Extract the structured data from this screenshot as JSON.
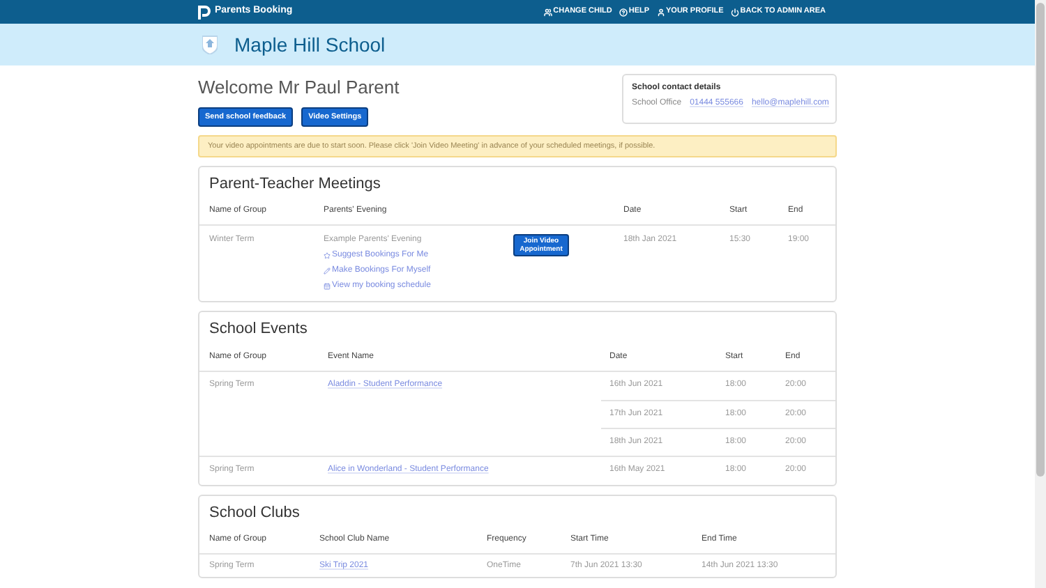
{
  "navbar": {
    "brand": "Parents Booking",
    "links": [
      {
        "label": "CHANGE CHILD"
      },
      {
        "label": "HELP"
      },
      {
        "label": "YOUR PROFILE"
      },
      {
        "label": "BACK TO ADMIN AREA"
      }
    ]
  },
  "school": {
    "name": "Maple Hill School"
  },
  "welcome": "Welcome Mr Paul Parent",
  "buttons": [
    "Send school feedback",
    "Video Settings"
  ],
  "contact": {
    "title": "School contact details",
    "label": "School Office",
    "phone": "01444 555666",
    "email": "hello@maplehill.com"
  },
  "alert": "Your video appointments are due to start soon. Please click 'Join Video Meeting' in advance of your scheduled meetings, if possible.",
  "meetings": {
    "title": "Parent-Teacher Meetings",
    "columns": [
      "Name of Group",
      "Parents' Evening",
      "Date",
      "Start",
      "End"
    ],
    "rows": [
      {
        "group": "Winter Term",
        "event": "Example Parents' Evening",
        "links": [
          "Suggest Bookings For Me",
          "Make Bookings For Myself",
          "View my booking schedule"
        ],
        "button": "Join Video Appointment",
        "date": "18th Jan 2021",
        "start": "15:30",
        "end": "19:00"
      }
    ]
  },
  "events": {
    "title": "School Events",
    "columns": [
      "Name of Group",
      "Event Name",
      "Date",
      "Start",
      "End"
    ],
    "rows": [
      {
        "group": "Spring Term",
        "event": "Aladdin - Student Performance",
        "sessions": [
          {
            "date": "16th Jun 2021",
            "start": "18:00",
            "end": "20:00"
          },
          {
            "date": "17th Jun 2021",
            "start": "18:00",
            "end": "20:00"
          },
          {
            "date": "18th Jun 2021",
            "start": "18:00",
            "end": "20:00"
          }
        ]
      },
      {
        "group": "Spring Term",
        "event": "Alice in Wonderland - Student Performance",
        "sessions": [
          {
            "date": "16th May 2021",
            "start": "18:00",
            "end": "20:00"
          }
        ]
      }
    ]
  },
  "clubs": {
    "title": "School Clubs",
    "columns": [
      "Name of Group",
      "School Club Name",
      "Frequency",
      "Start Time",
      "End Time"
    ],
    "rows": [
      {
        "group": "Spring Term",
        "name": "Ski Trip 2021",
        "frequency": "OneTime",
        "start": "7th Jun 2021 13:30",
        "end": "14th Jun 2021 13:30"
      }
    ]
  }
}
